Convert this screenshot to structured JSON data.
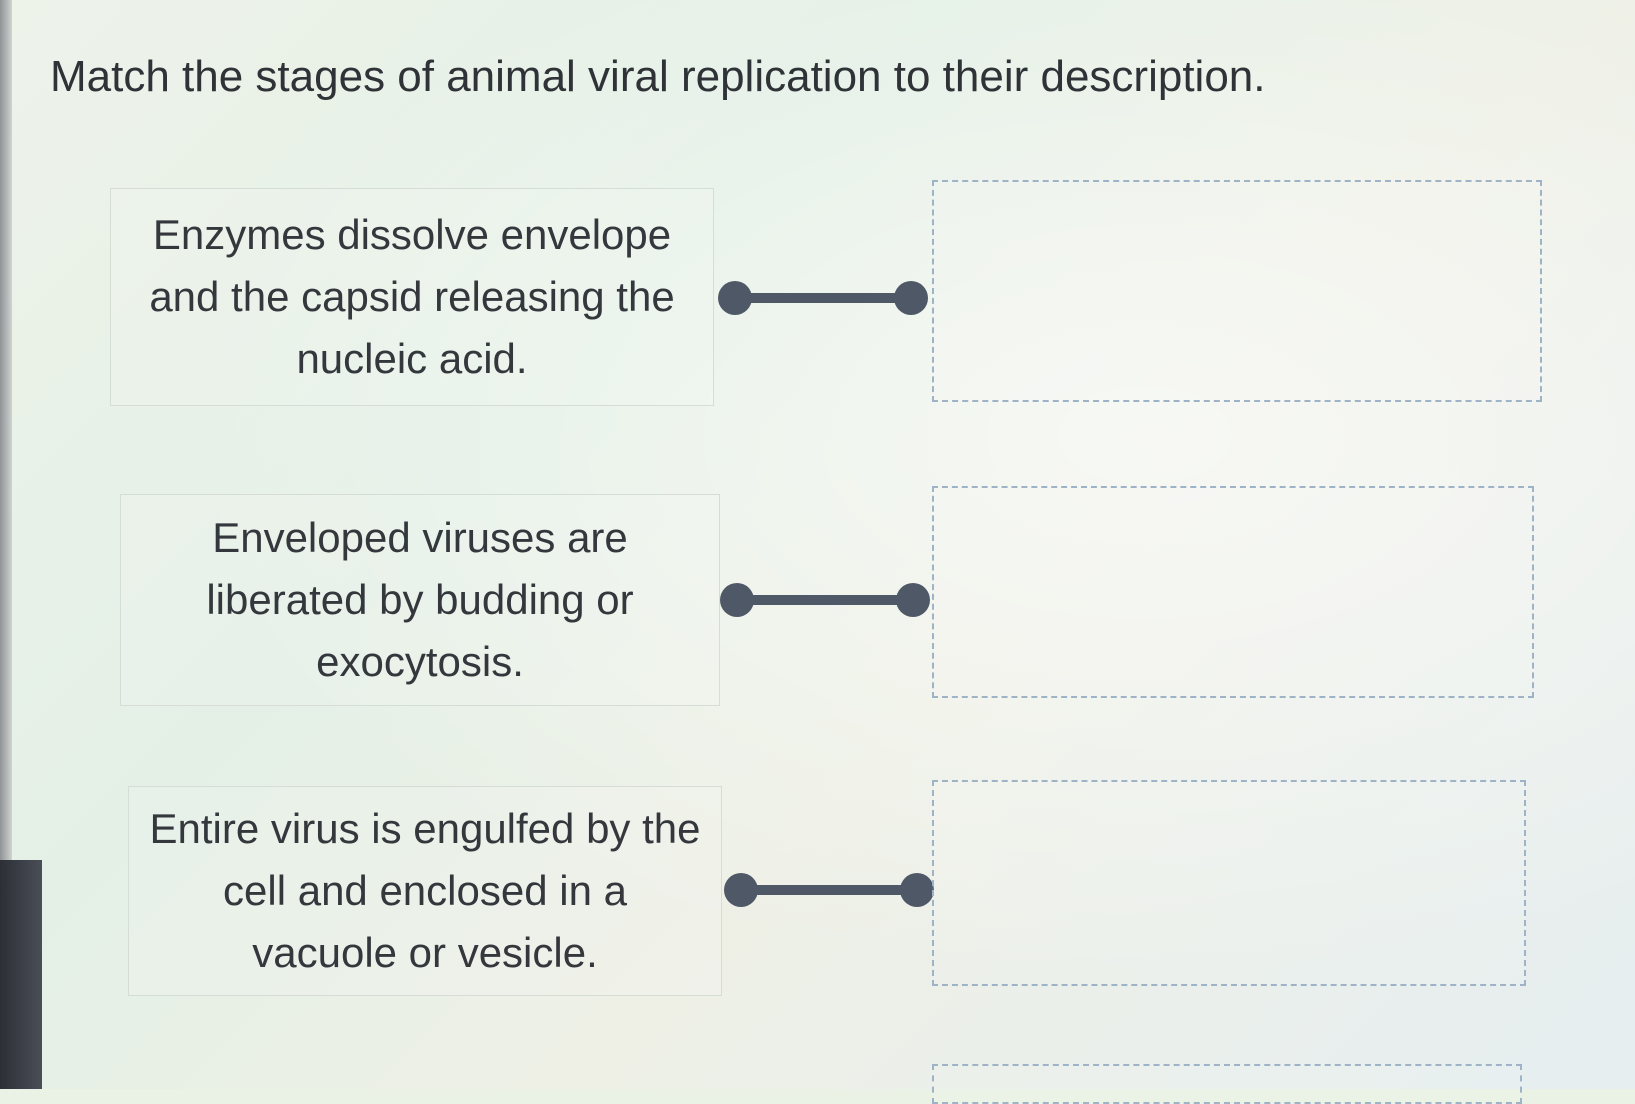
{
  "question": {
    "text": "Match the stages of animal viral replication to their description."
  },
  "descriptions": [
    {
      "text": "Enzymes dissolve envelope and the capsid releasing the nucleic acid."
    },
    {
      "text": "Enveloped viruses are liberated by budding or exocytosis."
    },
    {
      "text": "Entire virus is engulfed by the cell and enclosed in a vacuole or vesicle."
    }
  ],
  "colors": {
    "connector": "#4f5866",
    "dropzone_border": "#9fb3c7",
    "text": "#34383d"
  }
}
